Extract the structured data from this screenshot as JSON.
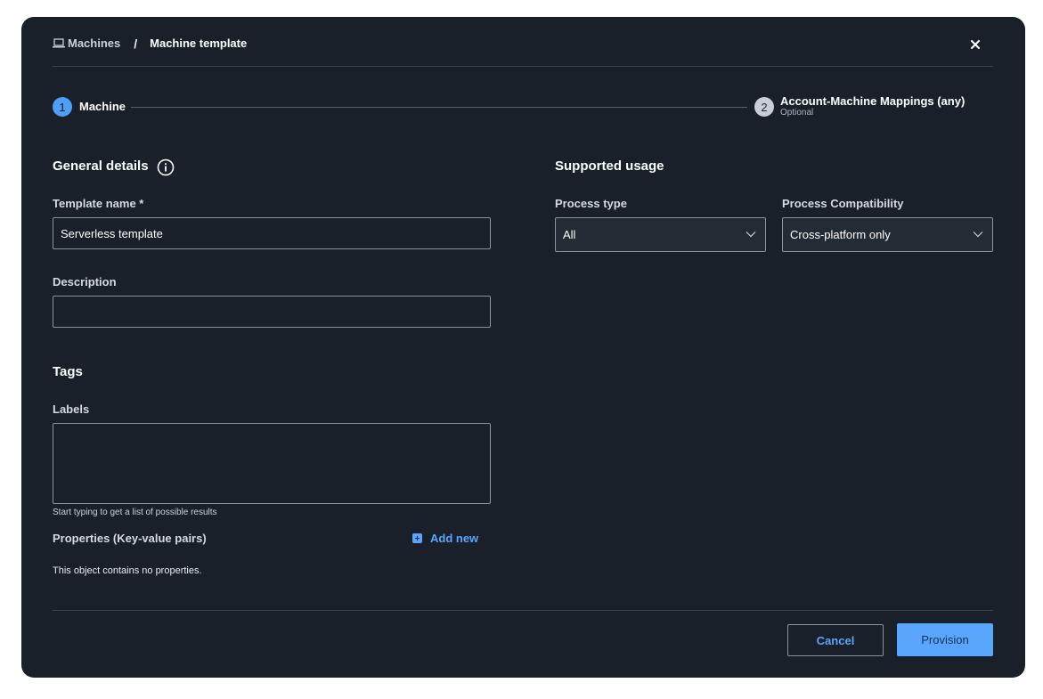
{
  "breadcrumb": {
    "parent_label": "Machines",
    "separator": "/",
    "current_label": "Machine template"
  },
  "close_icon": "close-icon",
  "stepper": {
    "steps": [
      {
        "number": "1",
        "label": "Machine",
        "state": "active"
      },
      {
        "number": "2",
        "label": "Account-Machine Mappings (any)",
        "sublabel": "Optional",
        "state": "inactive"
      }
    ]
  },
  "general": {
    "title": "General details",
    "info_icon": "info-icon",
    "template_name_label": "Template name *",
    "template_name_value": "Serverless template",
    "description_label": "Description",
    "description_value": ""
  },
  "tags": {
    "title": "Tags",
    "labels_label": "Labels",
    "labels_helper": "Start typing to get a list of possible results",
    "properties_label": "Properties (Key-value pairs)",
    "add_new_label": "Add new",
    "empty_properties": "This object contains no properties."
  },
  "usage": {
    "title": "Supported usage",
    "process_type_label": "Process type",
    "process_type_value": "All",
    "compat_label": "Process Compatibility",
    "compat_value": "Cross-platform only"
  },
  "footer": {
    "cancel_label": "Cancel",
    "provision_label": "Provision"
  },
  "colors": {
    "background": "#19202a",
    "accent": "#58a6ff",
    "step_active": "#4e9ff8"
  }
}
